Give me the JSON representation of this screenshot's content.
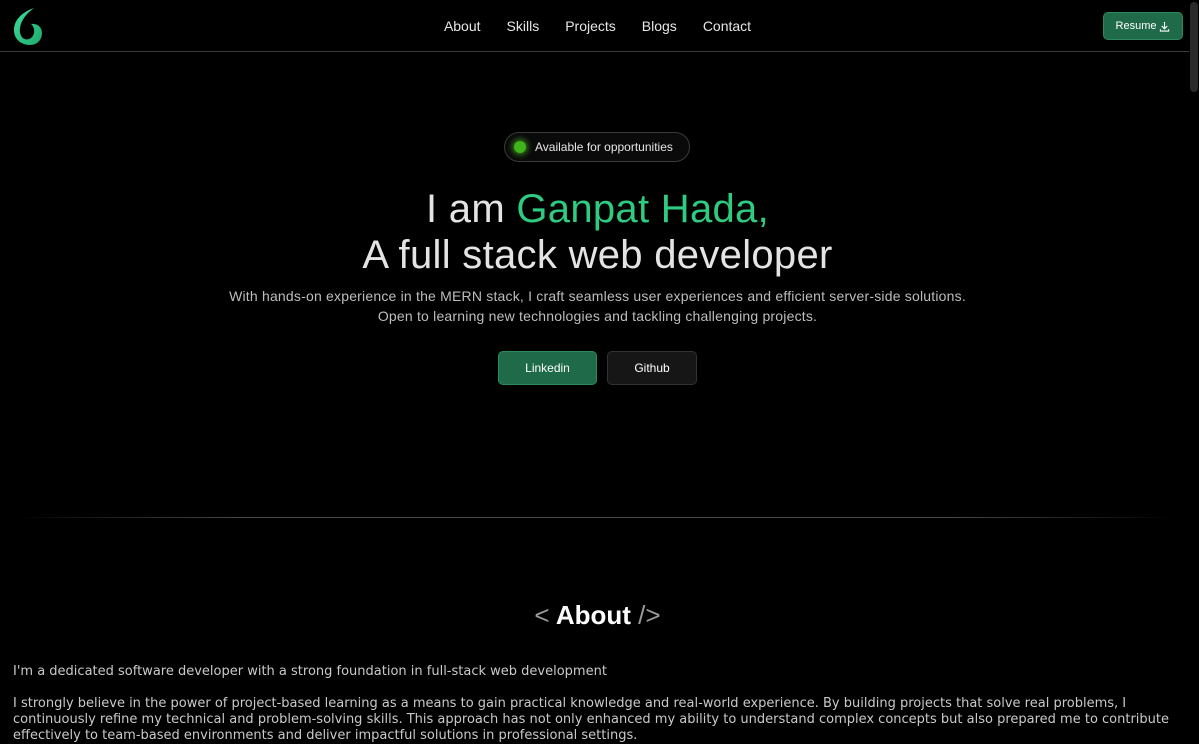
{
  "nav": {
    "logo": "logo-icon",
    "links": [
      "About",
      "Skills",
      "Projects",
      "Blogs",
      "Contact"
    ],
    "resume_label": "Resume",
    "resume_icon": "download-icon"
  },
  "hero": {
    "badge_text": "Available for opportunities",
    "status_color": "#3fb51a",
    "title_prefix": "I am ",
    "name": "Ganpat Hada,",
    "title_line2": "A full stack web developer",
    "desc_line1": "With hands-on experience in the MERN stack, I craft seamless user experiences and efficient server-side solutions.",
    "desc_line2": "Open to learning new technologies and tackling challenging projects.",
    "linkedin_label": "Linkedin",
    "github_label": "Github"
  },
  "about": {
    "open_bracket": "<",
    "title": "About",
    "close_bracket": "/>",
    "para1": "I'm a dedicated software developer with a strong foundation in full-stack web development",
    "para2": "I strongly believe in the power of project-based learning as a means to gain practical knowledge and real-world experience. By building projects that solve real problems, I continuously refine my technical and problem-solving skills. This approach has not only enhanced my ability to understand complex concepts but also prepared me to contribute effectively to team-based environments and deliver impactful solutions in professional settings."
  },
  "colors": {
    "accent": "#2ecc80",
    "button_green": "#1f6b49",
    "background": "#000000"
  }
}
